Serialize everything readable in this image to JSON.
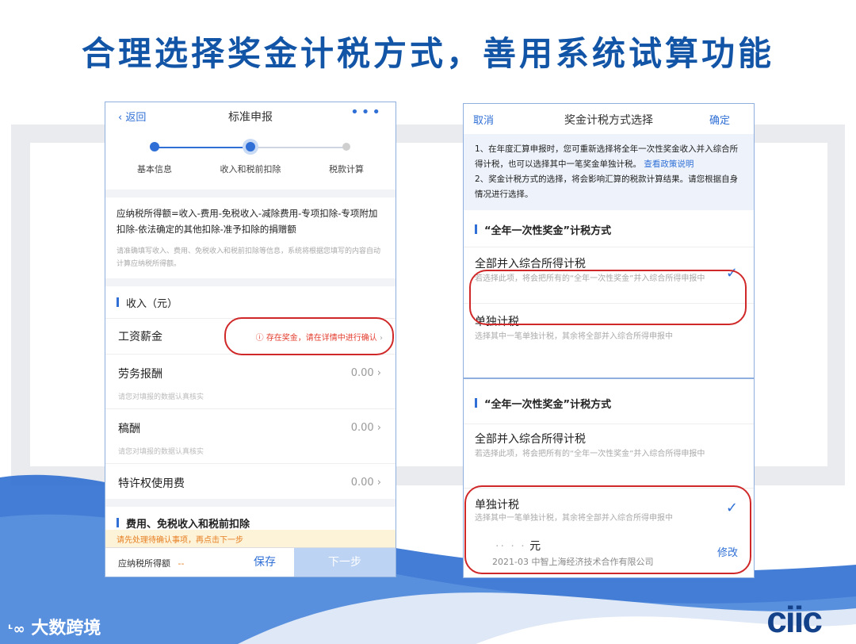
{
  "slide": {
    "title": "合理选择奖金计税方式，善用系统试算功能",
    "watermark": "大数跨境",
    "logo": "ciic",
    "colors": {
      "title": "#1254a6",
      "accent": "#2f6fd6",
      "warning": "#e33c2d",
      "highlight": "#d02828"
    }
  },
  "phone_left": {
    "nav": {
      "back": "返回",
      "title": "标准申报",
      "more_icon": "more-dots-icon"
    },
    "steps": [
      "基本信息",
      "收入和税前扣除",
      "税款计算"
    ],
    "formula": "应纳税所得额=收入-费用-免税收入-减除费用-专项扣除-专项附加扣除-依法确定的其他扣除-准予扣除的捐赠额",
    "formula_hint": "请准确填写收入、费用、免税收入和税前扣除等信息，系统将根据您填写的内容自动计算应纳税所得额。",
    "income_header": "收入（元）",
    "rows": [
      {
        "label": "工资薪金",
        "warning": "存在奖金，请在详情中进行确认"
      },
      {
        "label": "劳务报酬",
        "value": "0.00",
        "hint": "请您对填报的数据认真核实"
      },
      {
        "label": "稿酬",
        "value": "0.00",
        "hint": "请您对填报的数据认真核实"
      },
      {
        "label": "特许权使用费",
        "value": "0.00"
      }
    ],
    "deduction_header": "费用、免税收入和税前扣除",
    "tip": "请先处理待确认事项，再点击下一步",
    "bottom": {
      "due_label": "应纳税所得额",
      "due_value": "--",
      "save": "保存",
      "next": "下一步"
    }
  },
  "phone_right": {
    "nav": {
      "cancel": "取消",
      "title": "奖金计税方式选择",
      "confirm": "确定"
    },
    "info_1": "1、在年度汇算申报时，您可重新选择将全年一次性奖金收入并入综合所得计税，也可以选择其中一笔奖金单独计税。",
    "info_link": "查看政策说明",
    "info_2": "2、奖金计税方式的选择，将会影响汇算的税款计算结果。请您根据自身情况进行选择。",
    "section": "“全年一次性奖金”计税方式",
    "opt_all_title": "全部并入综合所得计税",
    "opt_all_desc": "若选择此项，将会把所有的“全年一次性奖金”并入综合所得申报中",
    "opt_single_title": "单独计税",
    "opt_single_desc": "选择其中一笔单独计税，其余将全部并入综合所得申报中"
  },
  "phone_right2": {
    "section": "“全年一次性奖金”计税方式",
    "opt_all_title": "全部并入综合所得计税",
    "opt_all_desc": "若选择此项，将会把所有的“全年一次性奖金”并入综合所得申报中",
    "opt_single_title": "单独计税",
    "opt_single_desc": "选择其中一笔单独计税，其余将全部并入综合所得申报中",
    "bonus_amount": "元",
    "bonus_meta": "2021-03 中智上海经济技术合作有限公司",
    "edit": "修改"
  }
}
